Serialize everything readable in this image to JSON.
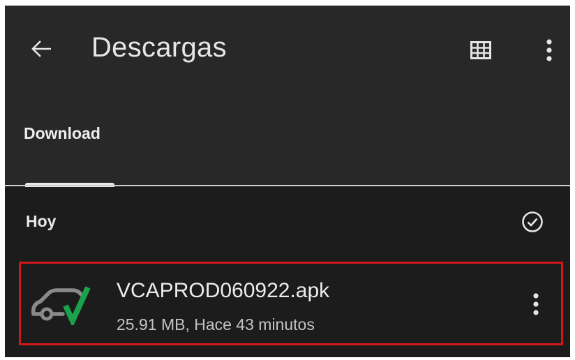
{
  "app_bar": {
    "title": "Descargas",
    "back_icon": "arrow-left-icon",
    "grid_icon": "grid-view-icon",
    "more_icon": "more-vert-icon"
  },
  "tabs": [
    {
      "label": "Download",
      "selected": true
    }
  ],
  "section": {
    "header": "Hoy",
    "select_icon": "check-circle-icon"
  },
  "files": [
    {
      "name": "VCAPROD060922.apk",
      "meta": "25.91 MB, Hace 43 minutos",
      "icon": "car-check-app-icon",
      "more_icon": "more-vert-icon",
      "highlighted": true
    }
  ],
  "colors": {
    "background": "#1c1c1c",
    "app_bar": "#282828",
    "text_primary": "#ececec",
    "text_secondary": "#c4c4c4",
    "highlight_border": "#d0181b",
    "icon_green": "#1aa14b",
    "icon_gray": "#8a8a8a"
  }
}
